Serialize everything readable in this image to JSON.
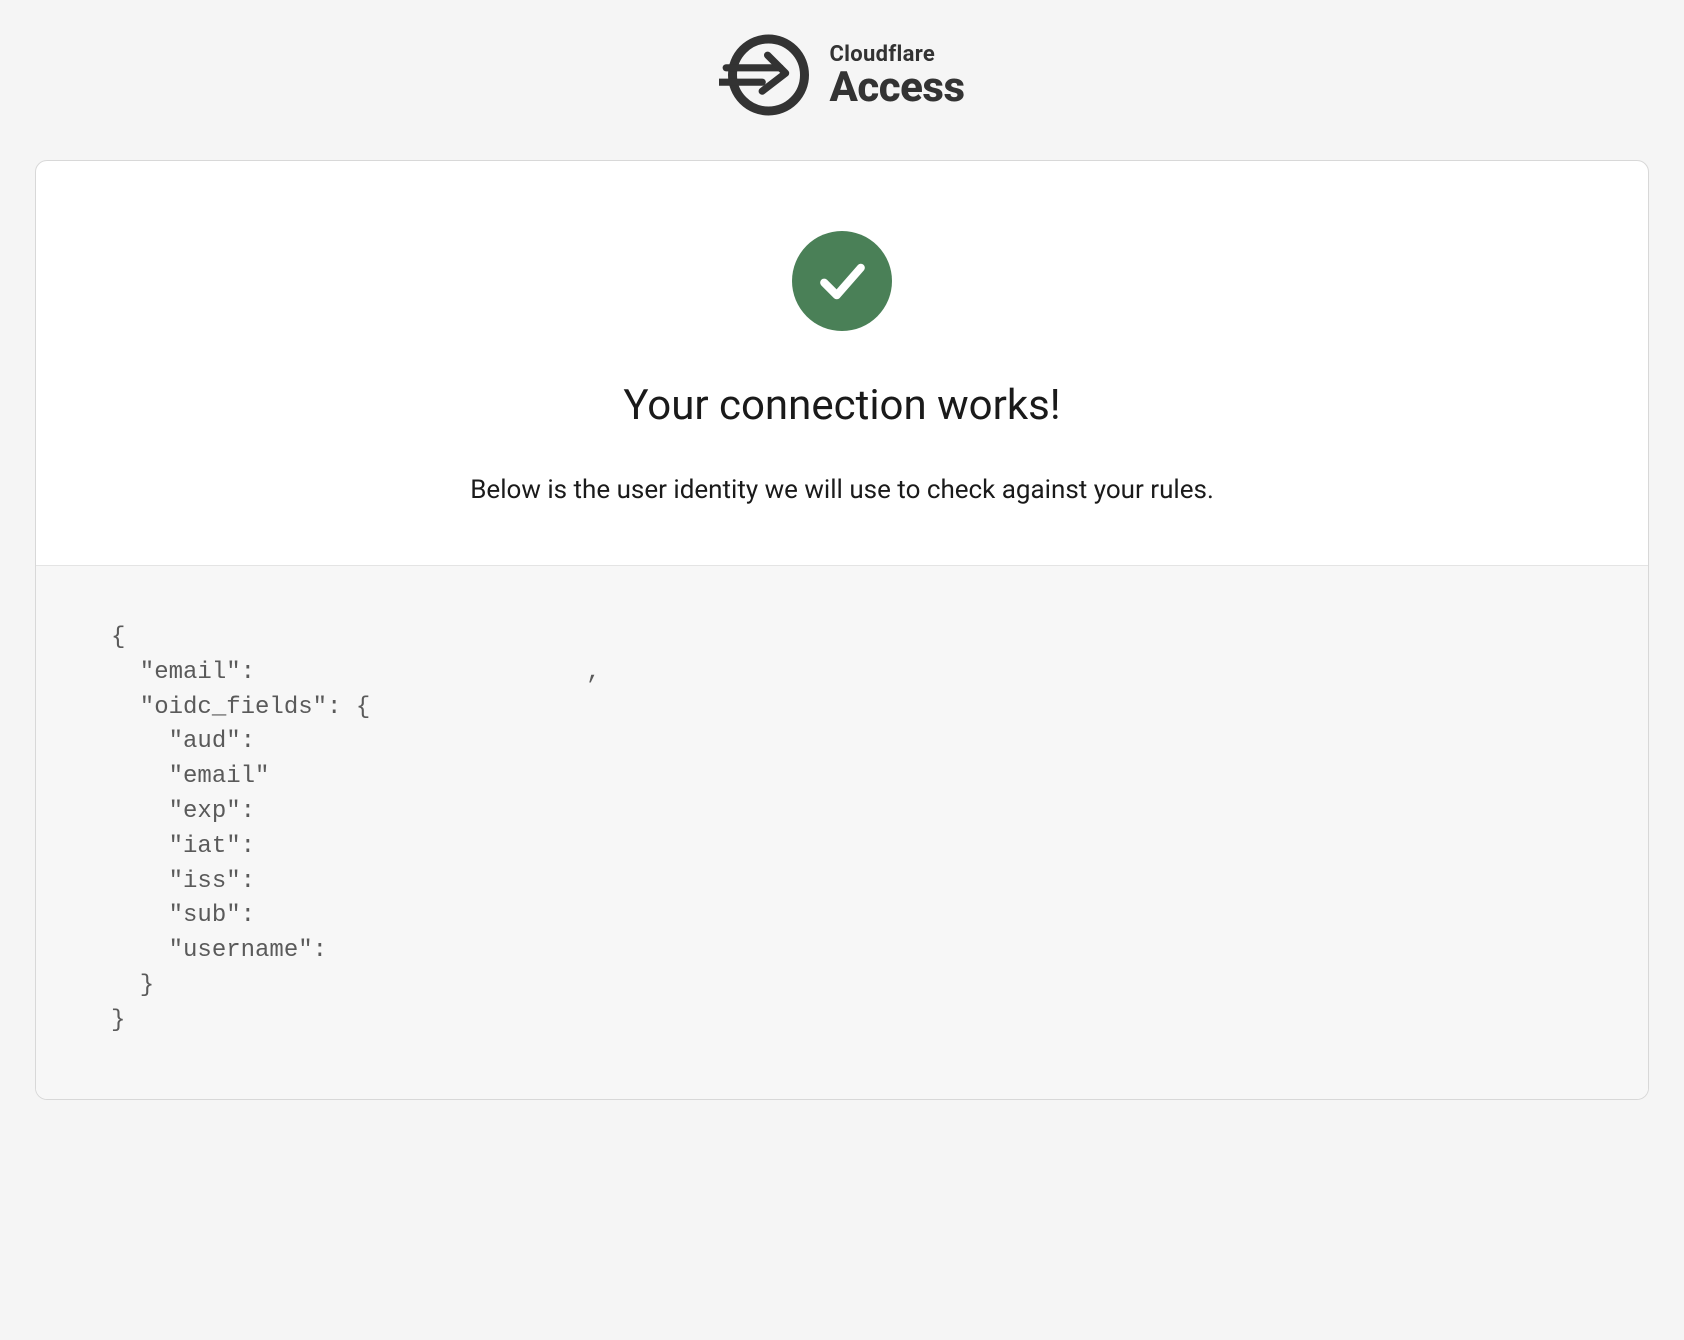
{
  "header": {
    "brand": "Cloudflare",
    "product": "Access"
  },
  "main": {
    "title": "Your connection works!",
    "subtitle": "Below is the user identity we will use to check against your rules."
  },
  "identity": {
    "code_text": "{\n  \"email\":                       ,\n  \"oidc_fields\": {\n    \"aud\":\n    \"email\"\n    \"exp\":\n    \"iat\":\n    \"iss\":\n    \"sub\":\n    \"username\":\n  }\n}"
  }
}
